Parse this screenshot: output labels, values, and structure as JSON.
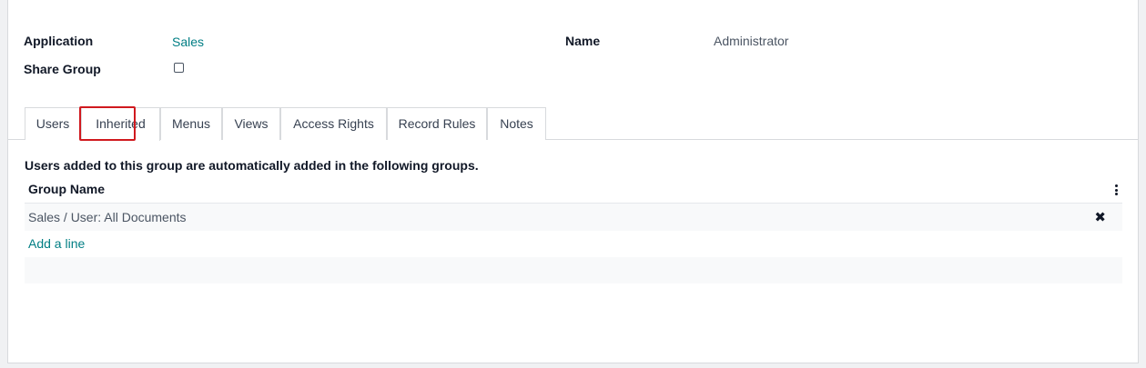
{
  "form": {
    "application_label": "Application",
    "application_value": "Sales",
    "share_group_label": "Share Group",
    "share_group_checked": false,
    "name_label": "Name",
    "name_value": "Administrator"
  },
  "tabs": [
    {
      "label": "Users"
    },
    {
      "label": "Inherited",
      "active": true
    },
    {
      "label": "Menus"
    },
    {
      "label": "Views"
    },
    {
      "label": "Access Rights"
    },
    {
      "label": "Record Rules"
    },
    {
      "label": "Notes"
    }
  ],
  "inherited": {
    "help_text": "Users added to this group are automatically added in the following groups.",
    "column_header": "Group Name",
    "rows": [
      {
        "group_name": "Sales / User: All Documents"
      }
    ],
    "add_line_label": "Add a line"
  },
  "icons": {
    "kebab": "vertical-dots-icon",
    "delete": "close-x-icon"
  },
  "colors": {
    "link": "#017e84",
    "highlight": "#d0191e"
  }
}
